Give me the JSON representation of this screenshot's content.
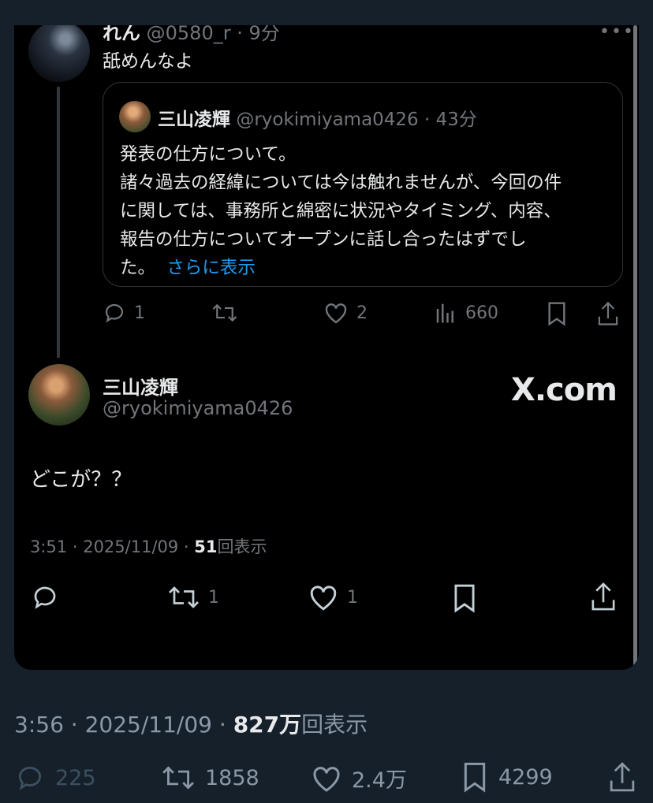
{
  "reply": {
    "name": "れん",
    "handle": "@0580_r",
    "time": "9分",
    "text": "舐めんなよ",
    "more_icon": "more-dots-icon"
  },
  "quoted": {
    "name": "三山凌輝",
    "handle": "@ryokimiyama0426",
    "time": "43分",
    "lines": [
      "発表の仕方について。",
      "諸々過去の経緯については今は触れませんが、今回の件",
      "に関しては、事務所と綿密に状況やタイミング、内容、",
      "報告の仕方についてオープンに話し合ったはずでし",
      "た。"
    ],
    "show_more": "さらに表示"
  },
  "reply_actions": {
    "replies": "1",
    "retweets": "",
    "likes": "2",
    "views": "660"
  },
  "main_tweet": {
    "name": "三山凌輝",
    "handle": "@ryokimiyama0426",
    "brand": "X.com",
    "text": "どこが？？",
    "time": "3:51",
    "date": "2025/11/09",
    "views_count": "51",
    "views_label": "回表示",
    "retweets": "1",
    "likes": "1"
  },
  "outer": {
    "time": "3:56",
    "date": "2025/11/09",
    "views_count": "827万",
    "views_label": "回表示",
    "replies": "225",
    "retweets": "1858",
    "likes": "2.4万",
    "bookmarks": "4299"
  },
  "colors": {
    "background": "#15202b",
    "card": "#000000",
    "text": "#e7e9ea",
    "muted": "#71767b",
    "link": "#1d9bf0"
  }
}
